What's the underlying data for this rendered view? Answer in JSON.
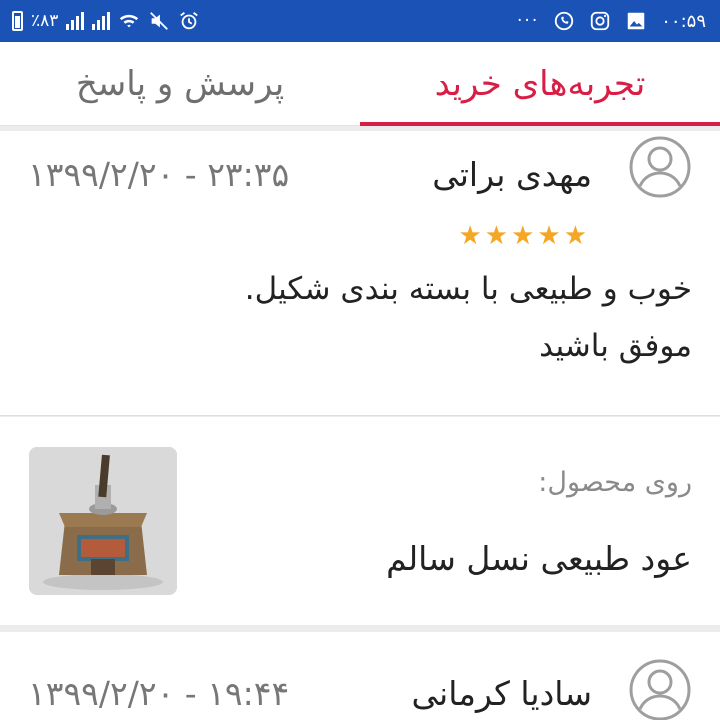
{
  "status_bar": {
    "time": "۰۰:۵۹",
    "battery": "٪۸۳",
    "more": "···",
    "icons_right": [
      "whatsapp-icon",
      "instagram-icon",
      "gallery-icon"
    ],
    "icons_left": [
      "battery-icon",
      "signal-icon",
      "signal-icon",
      "wifi-icon",
      "mute-icon",
      "alarm-icon"
    ]
  },
  "tabs": [
    {
      "label": "تجربه‌های خرید",
      "active": true
    },
    {
      "label": "پرسش و پاسخ",
      "active": false
    }
  ],
  "reviews": [
    {
      "reviewer": "مهدی براتی",
      "date": "۱۳۹۹/۲/۲۰ - ۲۳:۳۵",
      "stars": "★★★★★",
      "text_line1": "خوب و طبیعی با بسته بندی شکیل.",
      "text_line2": "موفق باشید"
    },
    {
      "reviewer": "سادیا کرمانی",
      "date": "۱۳۹۹/۲/۲۰ - ۱۹:۴۴"
    }
  ],
  "product": {
    "on_product_label": "روی محصول:",
    "name": "عود طبیعی نسل سالم"
  },
  "colors": {
    "status_bar": "#1a52b6",
    "accent": "#d81e45",
    "star": "#f5a623"
  }
}
